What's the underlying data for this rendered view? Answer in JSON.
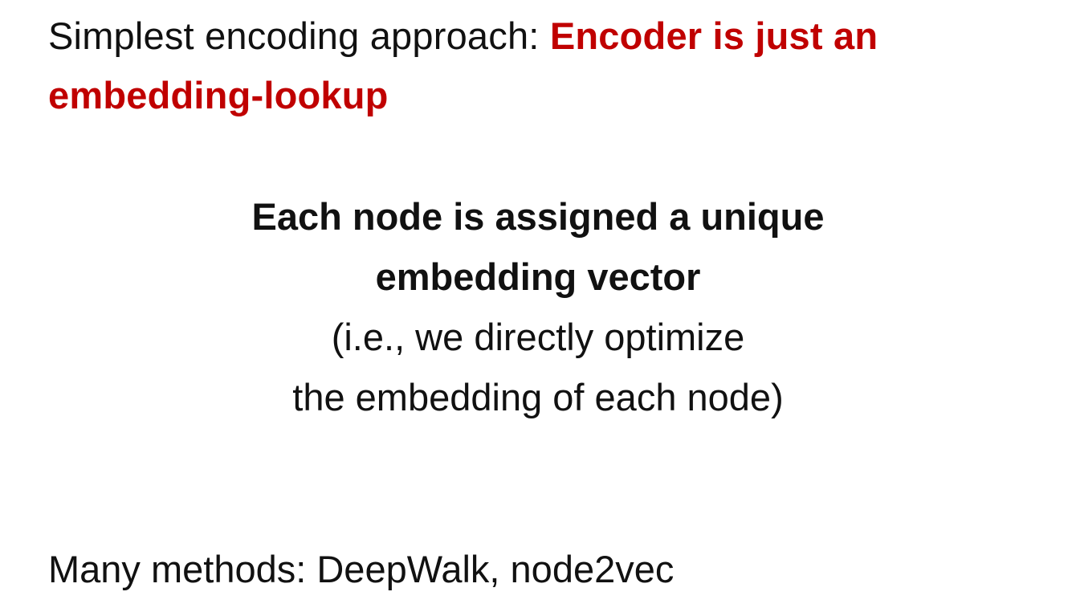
{
  "header": {
    "prefix": "Simplest encoding approach:",
    "highlight": "Encoder is just an embedding-lookup"
  },
  "main": {
    "bold_line_1": "Each node is assigned a unique",
    "bold_line_2": "embedding vector",
    "line_3": "(i.e., we directly optimize",
    "line_4": "the embedding of each node)"
  },
  "footer": {
    "text": "Many methods: DeepWalk, node2vec"
  },
  "colors": {
    "highlight": "#c00000",
    "text": "#111111",
    "background": "#ffffff"
  }
}
